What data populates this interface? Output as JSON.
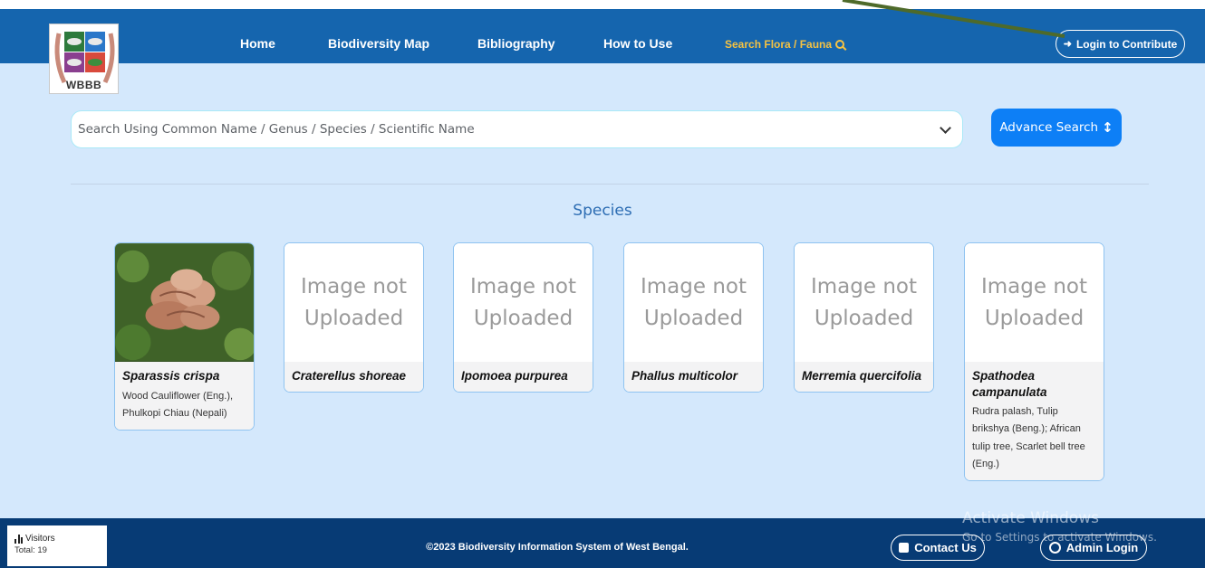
{
  "header": {
    "logo_text": "WBBB",
    "nav": {
      "home": "Home",
      "map": "Biodiversity Map",
      "bibliography": "Bibliography",
      "how_to_use": "How to Use",
      "search": "Search Flora / Fauna"
    },
    "login_label": "Login to Contribute"
  },
  "search": {
    "placeholder": "Search Using Common Name / Genus / Species / Scientific Name",
    "advance_label": "Advance Search"
  },
  "section_title": "Species",
  "cards": [
    {
      "image_text": "",
      "scientific": "Sparassis crispa",
      "common": "Wood Cauliflower (Eng.), Phulkopi Chiau (Nepali)"
    },
    {
      "image_text": "Image not Uploaded",
      "scientific": "Craterellus shoreae",
      "common": ""
    },
    {
      "image_text": "Image not Uploaded",
      "scientific": "Ipomoea purpurea",
      "common": ""
    },
    {
      "image_text": "Image not Uploaded",
      "scientific": "Phallus multicolor",
      "common": ""
    },
    {
      "image_text": "Image not Uploaded",
      "scientific": "Merremia quercifolia",
      "common": ""
    },
    {
      "image_text": "Image not Uploaded",
      "scientific": "Spathodea campanulata",
      "common": "Rudra palash, Tulip brikshya (Beng.); African tulip tree, Scarlet bell tree (Eng.)"
    }
  ],
  "footer": {
    "visitors_label": "Visitors",
    "visitors_total": "Total: 19",
    "copyright": "©2023 Biodiversity Information System of West Bengal.",
    "contact_label": "Contact Us",
    "admin_label": "Admin Login"
  },
  "watermark": {
    "line1": "Activate Windows",
    "line2": "Go to Settings to activate Windows."
  },
  "colors": {
    "navbar": "#1565ae",
    "main_bg": "#d4e8fc",
    "footer": "#073b75",
    "accent": "#0d7ff6",
    "search_highlight": "#f5c242"
  }
}
